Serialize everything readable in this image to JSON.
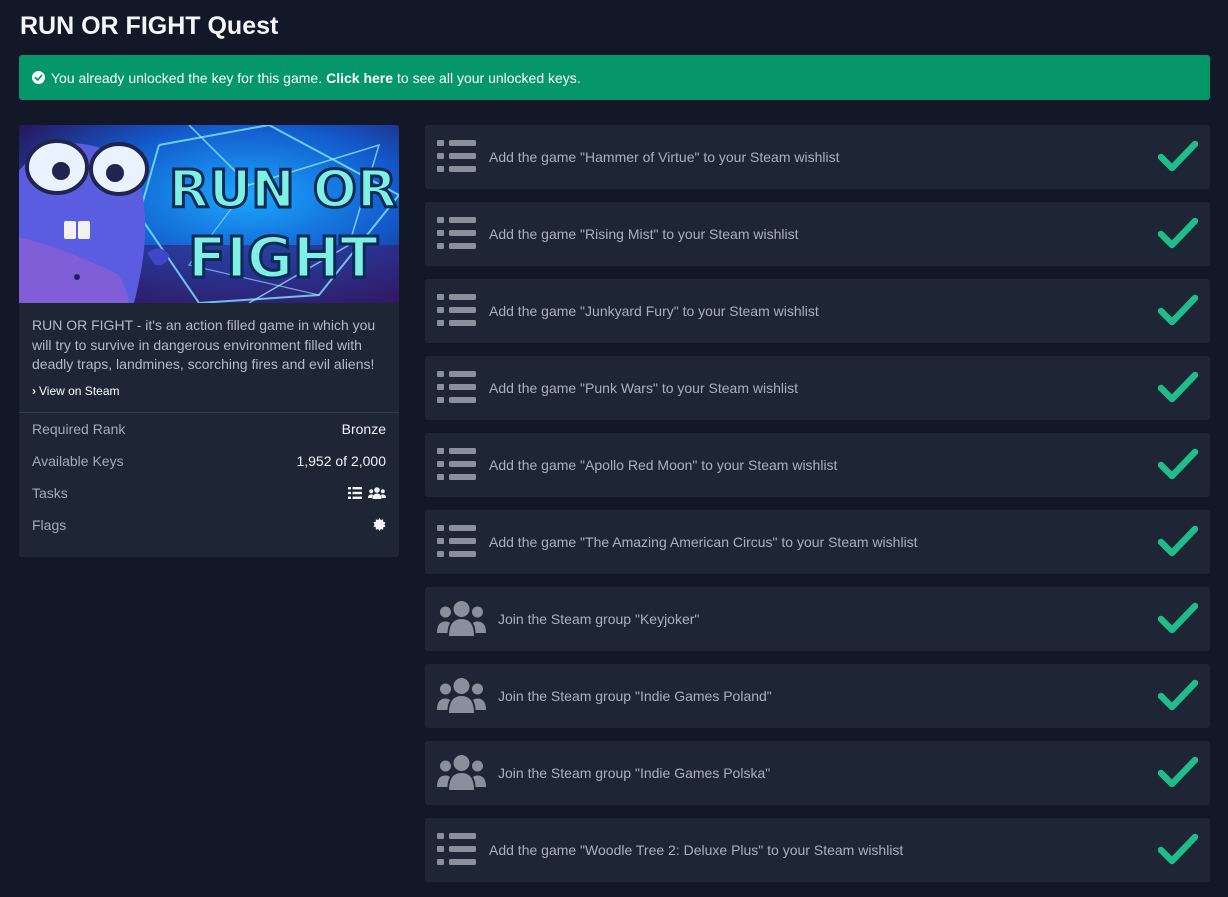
{
  "page": {
    "title": "RUN OR FIGHT Quest"
  },
  "alert": {
    "before": "You already unlocked the key for this game.",
    "link": "Click here",
    "after": "to see all your unlocked keys.",
    "color": "#05976a"
  },
  "game": {
    "banner_title_line1": "RUN OR",
    "banner_title_line2": "FIGHT",
    "description": "RUN OR FIGHT - it's an action filled game in which you will try to survive in dangerous environment filled with deadly traps, landmines, scorching fires and evil aliens!",
    "steam_link": "View on Steam"
  },
  "info": {
    "rank_label": "Required Rank",
    "rank_value": "Bronze",
    "keys_label": "Available Keys",
    "keys_value": "1,952 of 2,000",
    "tasks_label": "Tasks",
    "tasks_icons": [
      "list-icon",
      "users-icon"
    ],
    "flags_label": "Flags",
    "flags_icons": [
      "badge-icon"
    ]
  },
  "tasks": [
    {
      "type": "wishlist",
      "icon": "list-icon",
      "text": "Add the game \"Hammer of Virtue\" to your Steam wishlist",
      "completed": true
    },
    {
      "type": "wishlist",
      "icon": "list-icon",
      "text": "Add the game \"Rising Mist\" to your Steam wishlist",
      "completed": true
    },
    {
      "type": "wishlist",
      "icon": "list-icon",
      "text": "Add the game \"Junkyard Fury\" to your Steam wishlist",
      "completed": true
    },
    {
      "type": "wishlist",
      "icon": "list-icon",
      "text": "Add the game \"Punk Wars\" to your Steam wishlist",
      "completed": true
    },
    {
      "type": "wishlist",
      "icon": "list-icon",
      "text": "Add the game \"Apollo Red Moon\" to your Steam wishlist",
      "completed": true
    },
    {
      "type": "wishlist",
      "icon": "list-icon",
      "text": "Add the game \"The Amazing American Circus\" to your Steam wishlist",
      "completed": true
    },
    {
      "type": "group",
      "icon": "users-icon",
      "text": "Join the Steam group \"Keyjoker\"",
      "completed": true
    },
    {
      "type": "group",
      "icon": "users-icon",
      "text": "Join the Steam group \"Indie Games Poland\"",
      "completed": true
    },
    {
      "type": "group",
      "icon": "users-icon",
      "text": "Join the Steam group \"Indie Games Polska\"",
      "completed": true
    },
    {
      "type": "wishlist",
      "icon": "list-icon",
      "text": "Add the game \"Woodle Tree 2: Deluxe Plus\" to your Steam wishlist",
      "completed": true
    }
  ],
  "colors": {
    "background": "#121828",
    "card": "#1e2636",
    "check": "#1fbd8a",
    "icon": "#8a909b"
  }
}
